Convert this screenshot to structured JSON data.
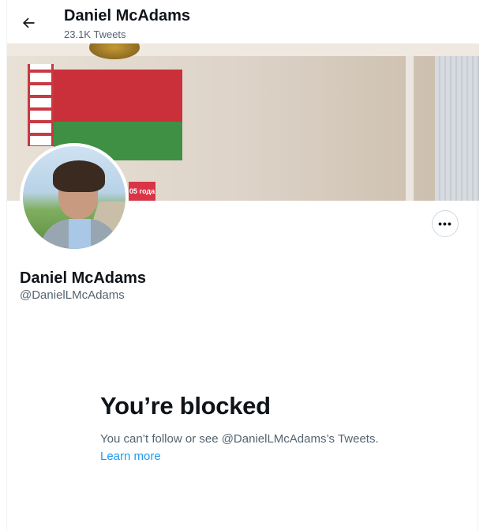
{
  "header": {
    "title": "Daniel McAdams",
    "tweet_count": "23.1K Tweets",
    "back_icon": "arrow-left-icon"
  },
  "banner": {
    "sign_text": "05 года"
  },
  "profile": {
    "name": "Daniel McAdams",
    "handle": "@DanielLMcAdams",
    "more_icon": "more-horizontal-icon",
    "more_label": "•••"
  },
  "blocked": {
    "heading": "You’re blocked",
    "message": "You can’t follow or see @DanielLMcAdams’s Tweets.",
    "learn_more": "Learn more",
    "link_color": "#1d9bf0"
  },
  "colors": {
    "text_primary": "#0f1419",
    "text_secondary": "#536471",
    "border": "#cfd9de"
  }
}
